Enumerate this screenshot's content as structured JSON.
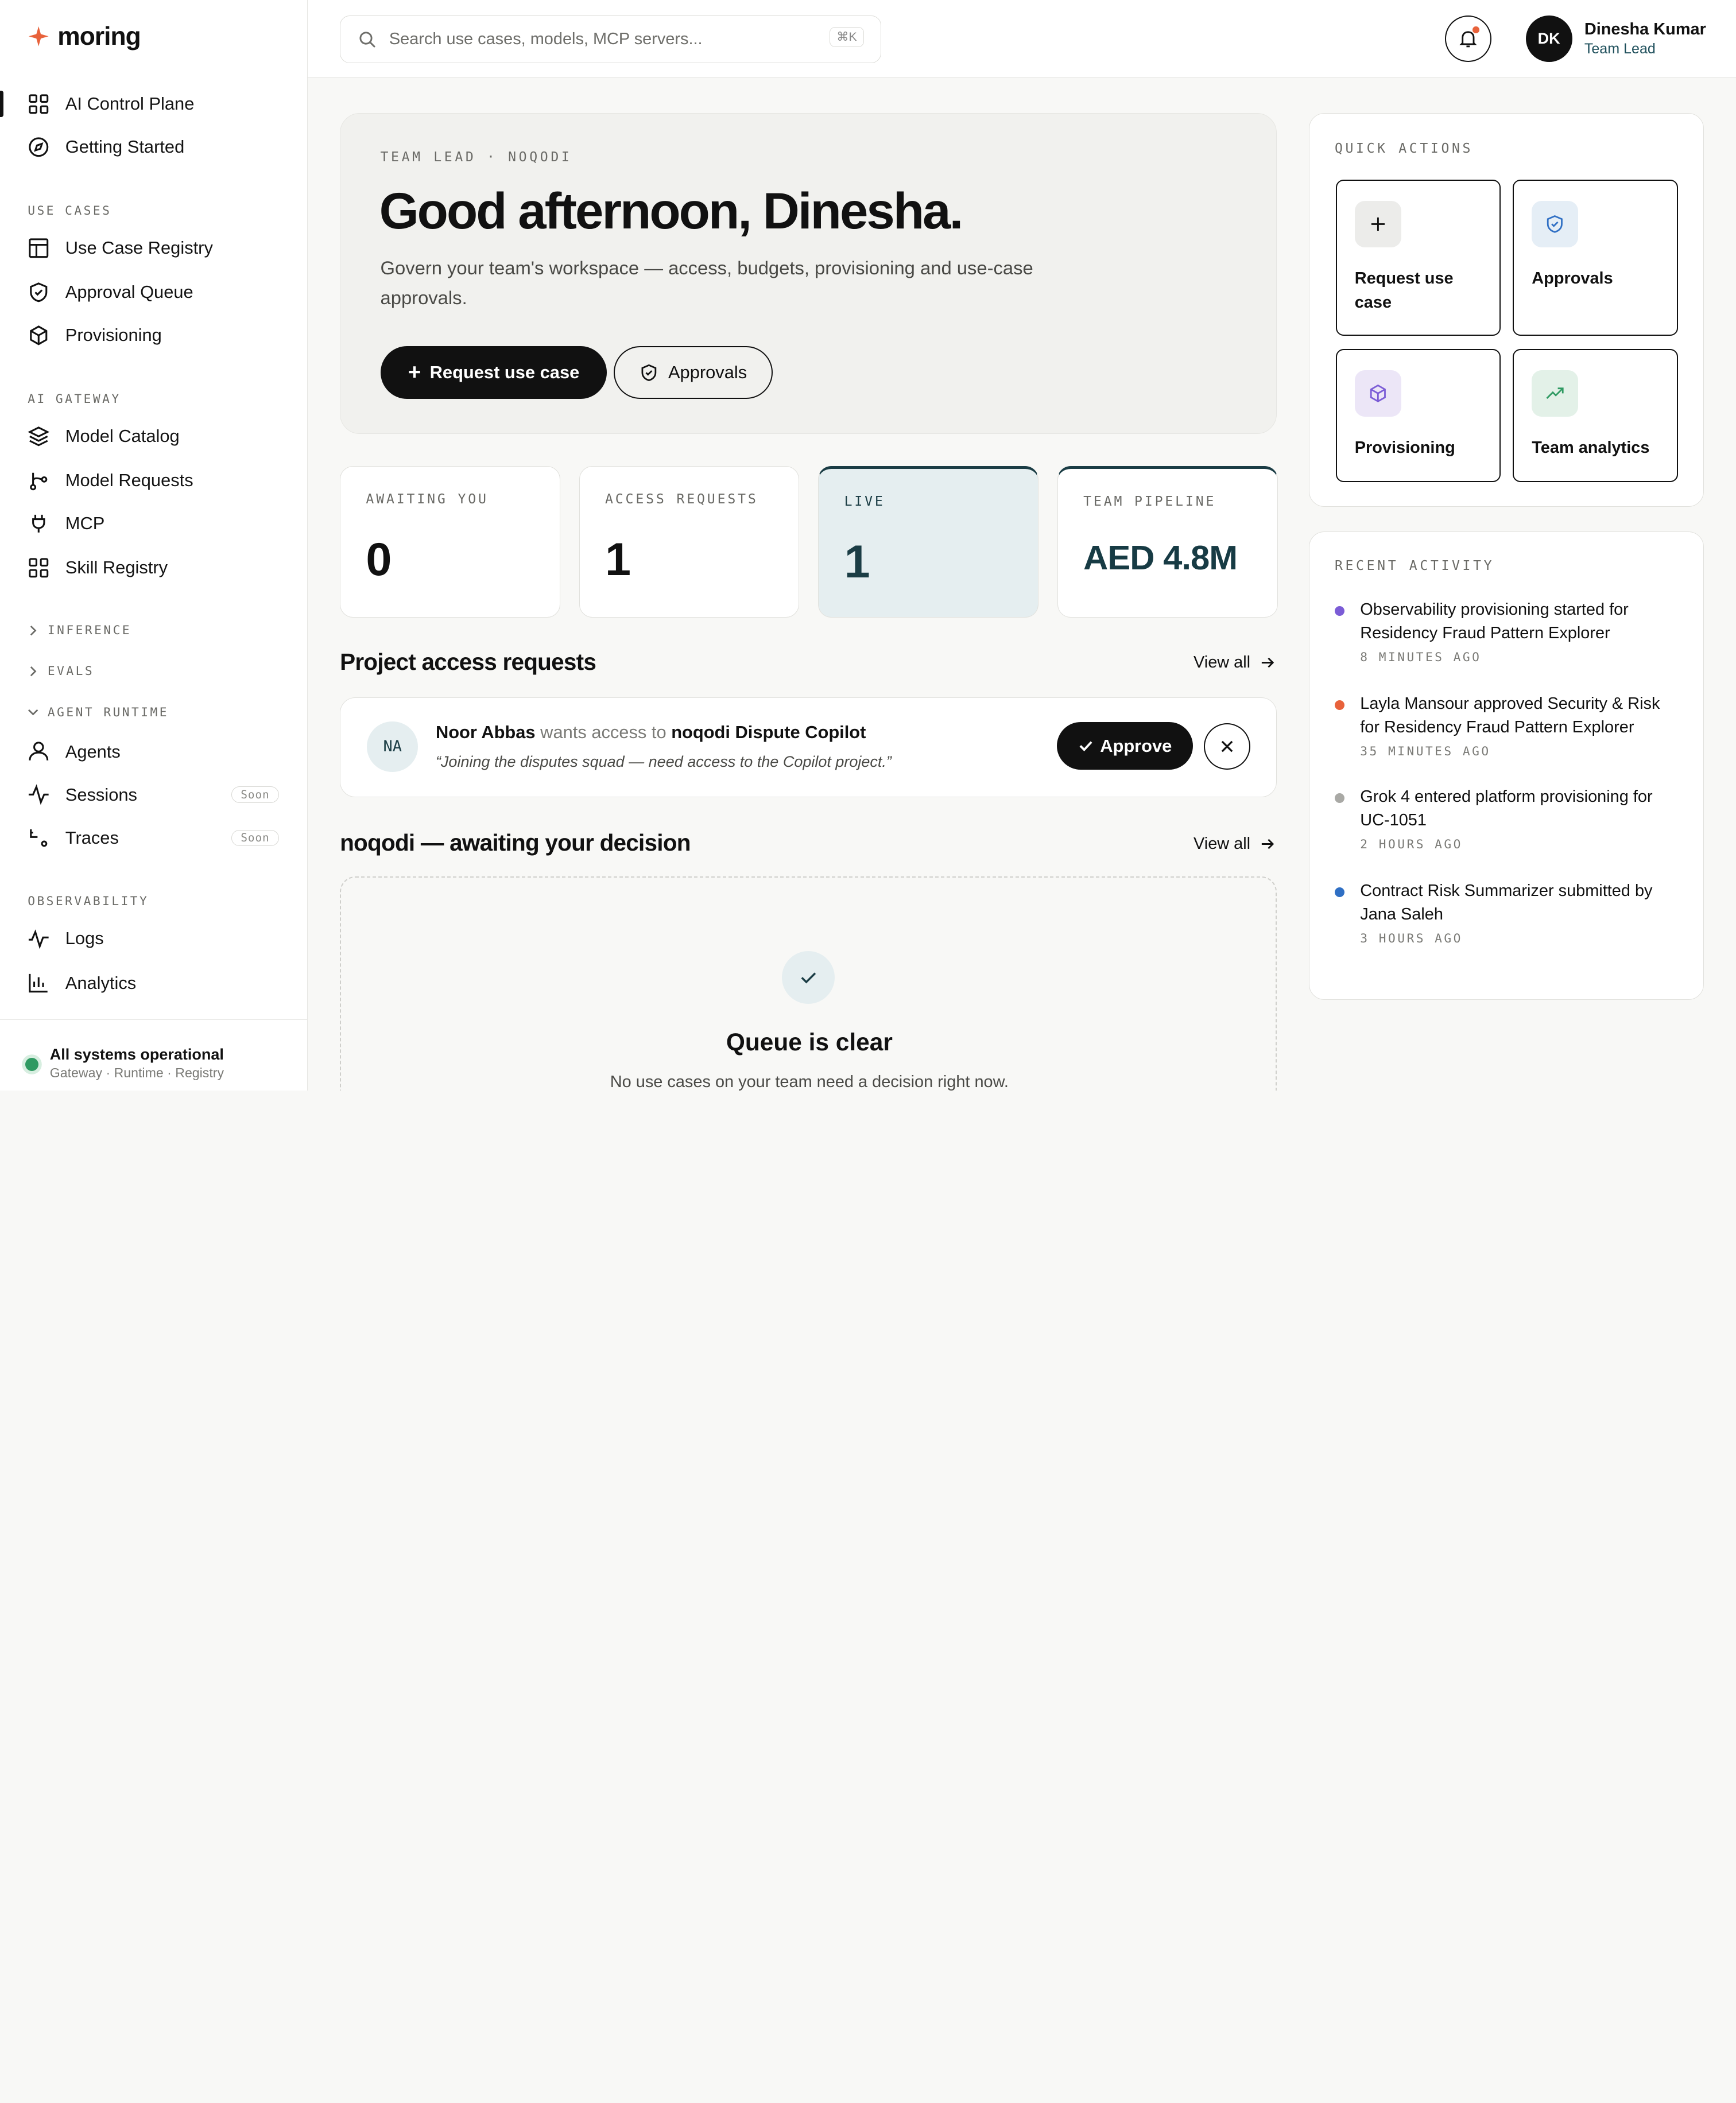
{
  "brand": {
    "name": "moring",
    "accent": "#e8623b"
  },
  "sidebar": {
    "top_items": [
      {
        "label": "AI Control Plane",
        "icon": "grid-icon",
        "active": true
      },
      {
        "label": "Getting Started",
        "icon": "compass-icon"
      }
    ],
    "sections": {
      "use_cases": "USE CASES",
      "ai_gateway": "AI GATEWAY",
      "inference": "INFERENCE",
      "evals": "EVALS",
      "agent_runtime": "AGENT RUNTIME",
      "observability": "OBSERVABILITY"
    },
    "use_cases": [
      {
        "label": "Use Case Registry",
        "icon": "table-icon"
      },
      {
        "label": "Approval Queue",
        "icon": "shield-check-icon"
      },
      {
        "label": "Provisioning",
        "icon": "box-icon"
      }
    ],
    "ai_gateway": [
      {
        "label": "Model Catalog",
        "icon": "layers-icon"
      },
      {
        "label": "Model Requests",
        "icon": "route-icon"
      },
      {
        "label": "MCP",
        "icon": "plug-icon"
      },
      {
        "label": "Skill Registry",
        "icon": "grid-icon"
      }
    ],
    "agent_runtime": [
      {
        "label": "Agents",
        "icon": "user-icon"
      },
      {
        "label": "Sessions",
        "icon": "activity-icon",
        "badge": "Soon"
      },
      {
        "label": "Traces",
        "icon": "trace-icon",
        "badge": "Soon"
      }
    ],
    "observability": [
      {
        "label": "Logs",
        "icon": "pulse-icon"
      },
      {
        "label": "Analytics",
        "icon": "bar-chart-icon"
      }
    ],
    "status": {
      "title": "All systems operational",
      "subtitle": "Gateway · Runtime · Registry"
    }
  },
  "topbar": {
    "search_placeholder": "Search use cases, models, MCP servers...",
    "shortcut": "⌘K",
    "user": {
      "initials": "DK",
      "name": "Dinesha Kumar",
      "role": "Team Lead"
    }
  },
  "hero": {
    "eyebrow": "TEAM LEAD · NOQODI",
    "greeting": "Good afternoon, Dinesha.",
    "subtitle": "Govern your team's workspace — access, budgets, provisioning and use-case approvals.",
    "primary_button": "Request use case",
    "secondary_button": "Approvals"
  },
  "stats": [
    {
      "label": "AWAITING YOU",
      "value": "0"
    },
    {
      "label": "ACCESS REQUESTS",
      "value": "1"
    },
    {
      "label": "LIVE",
      "value": "1"
    },
    {
      "label": "TEAM PIPELINE",
      "value": "AED 4.8M"
    }
  ],
  "access_requests": {
    "title": "Project access requests",
    "view_all": "View all",
    "items": [
      {
        "initials": "NA",
        "name": "Noor Abbas",
        "verb": "wants access to",
        "project": "noqodi Dispute Copilot",
        "quote": "“Joining the disputes squad — need access to the Copilot project.”",
        "approve_label": "Approve"
      }
    ]
  },
  "decision": {
    "title": "noqodi — awaiting your decision",
    "view_all": "View all",
    "empty_title": "Queue is clear",
    "empty_subtitle": "No use cases on your team need a decision right now."
  },
  "quick_actions": {
    "label": "QUICK ACTIONS",
    "items": [
      {
        "label": "Request use case",
        "icon": "plus-icon"
      },
      {
        "label": "Approvals",
        "icon": "shield-check-icon"
      },
      {
        "label": "Provisioning",
        "icon": "box-icon"
      },
      {
        "label": "Team analytics",
        "icon": "trending-up-icon"
      }
    ]
  },
  "recent_activity": {
    "label": "RECENT ACTIVITY",
    "items": [
      {
        "text": "Observability provisioning started for Residency Fraud Pattern Explorer",
        "time": "8 MINUTES AGO",
        "color": "#7b5cd6"
      },
      {
        "text": "Layla Mansour approved Security & Risk for Residency Fraud Pattern Explorer",
        "time": "35 MINUTES AGO",
        "color": "#e8623b"
      },
      {
        "text": "Grok 4 entered platform provisioning for UC-1051",
        "time": "2 HOURS AGO",
        "color": "#a9a9a5"
      },
      {
        "text": "Contract Risk Summarizer submitted by Jana Saleh",
        "time": "3 HOURS AGO",
        "color": "#2f6fc4"
      }
    ]
  }
}
